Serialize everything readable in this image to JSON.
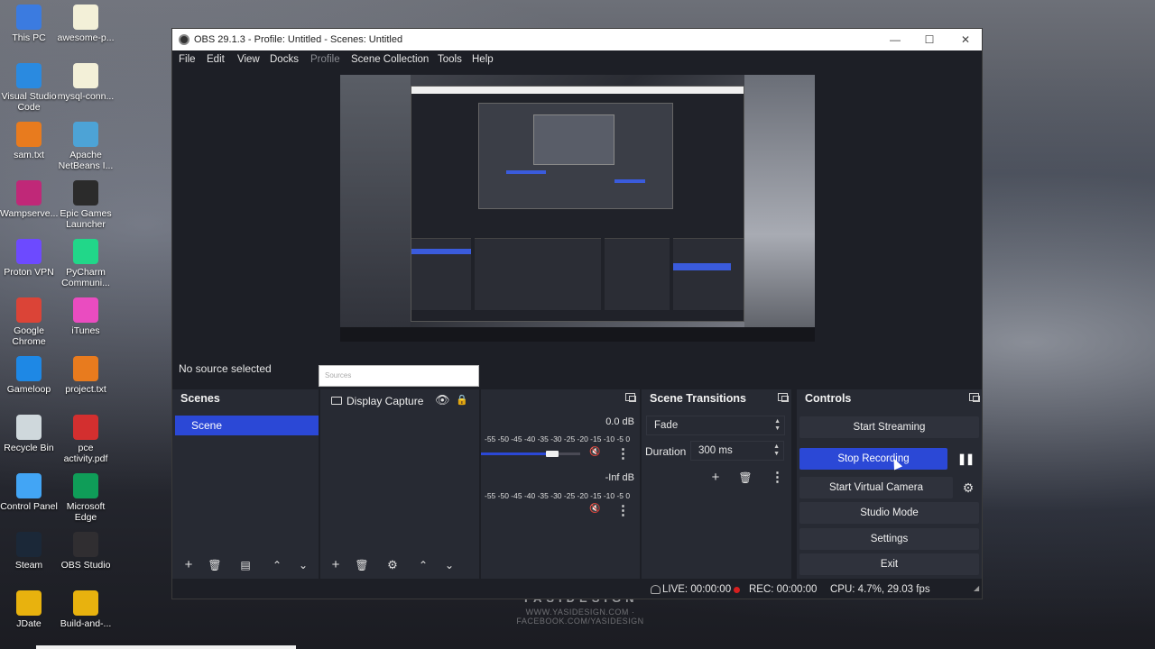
{
  "desktop": {
    "icons": [
      {
        "label": "This PC",
        "color": "#3b7be0"
      },
      {
        "label": "awesome-p...",
        "color": "#f3f0d8"
      },
      {
        "label": "Visual Studio Code",
        "color": "#2a8ae0"
      },
      {
        "label": "mysql-conn...",
        "color": "#f3f0d8"
      },
      {
        "label": "sam.txt",
        "color": "#e87b1e"
      },
      {
        "label": "Apache NetBeans I...",
        "color": "#4da3d6"
      },
      {
        "label": "Wampserve...",
        "color": "#c02878"
      },
      {
        "label": "Epic Games Launcher",
        "color": "#2b2b2b"
      },
      {
        "label": "Proton VPN",
        "color": "#6d4aff"
      },
      {
        "label": "PyCharm Communi...",
        "color": "#21d789"
      },
      {
        "label": "Google Chrome",
        "color": "#db4437"
      },
      {
        "label": "iTunes",
        "color": "#ea4cc0"
      },
      {
        "label": "Gameloop",
        "color": "#1e88e5"
      },
      {
        "label": "project.txt",
        "color": "#e87b1e"
      },
      {
        "label": "Recycle Bin",
        "color": "#cfd8dc"
      },
      {
        "label": "pce activity.pdf",
        "color": "#d32f2f"
      },
      {
        "label": "Control Panel",
        "color": "#42a5f5"
      },
      {
        "label": "Microsoft Edge",
        "color": "#0f9d58"
      },
      {
        "label": "Steam",
        "color": "#1b2838"
      },
      {
        "label": "OBS Studio",
        "color": "#302e31"
      },
      {
        "label": "JDate",
        "color": "#e8b20e"
      },
      {
        "label": "Build-and-...",
        "color": "#e8b20e"
      }
    ],
    "watermark_main": "YASIDESIGN",
    "watermark_sub": "WWW.YASIDESIGN.COM · FACEBOOK.COM/YASIDESIGN"
  },
  "window": {
    "title": "OBS 29.1.3 - Profile: Untitled - Scenes: Untitled",
    "minimize": "—",
    "maximize": "☐",
    "close": "✕"
  },
  "menu": {
    "file": "File",
    "edit": "Edit",
    "view": "View",
    "docks": "Docks",
    "profile": "Profile",
    "scene_collection": "Scene Collection",
    "tools": "Tools",
    "help": "Help"
  },
  "preview": {
    "no_source": "No source selected",
    "tooltip": "Sources"
  },
  "scenes": {
    "title": "Scenes",
    "items": [
      "Scene"
    ]
  },
  "sources": {
    "items": [
      {
        "label": "Display Capture"
      }
    ]
  },
  "mixer": {
    "channel1_db": "0.0 dB",
    "channel2_db": "-Inf dB",
    "scale": "-55  -50  -45  -40  -35  -30  -25  -20  -15  -10  -5  0",
    "channel1_volume": 0.75
  },
  "transitions": {
    "title": "Scene Transitions",
    "selected": "Fade",
    "duration_label": "Duration",
    "duration_value": "300 ms"
  },
  "controls": {
    "title": "Controls",
    "start_streaming": "Start Streaming",
    "stop_recording": "Stop Recording",
    "start_virtual_camera": "Start Virtual Camera",
    "studio_mode": "Studio Mode",
    "settings": "Settings",
    "exit": "Exit"
  },
  "status": {
    "live": "LIVE: 00:00:00",
    "rec": "REC: 00:00:00",
    "cpu": "CPU: 4.7%, 29.03 fps"
  },
  "colors": {
    "accent": "#2b48d6",
    "window_bg": "#1d1f26",
    "dock_bg": "#272a33",
    "rec": "#d61f1f"
  }
}
